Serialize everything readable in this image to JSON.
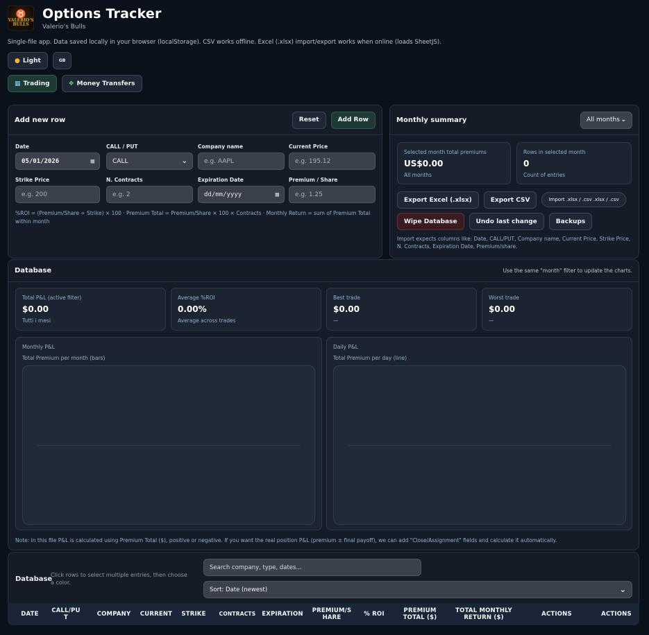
{
  "app": {
    "logo_text": "VALERIO'S BULLS",
    "title": "Options Tracker",
    "subtitle": "Valerio's Bulls",
    "note": "Single-file app. Data saved locally in your browser (localStorage). CSV works offline. Excel (.xlsx) import/export works when online (loads SheetJS)."
  },
  "toolbar": {
    "light_label": "Light",
    "gb_label": "GB"
  },
  "nav": {
    "trading_label": "Trading",
    "money_label": "Money Transfers"
  },
  "add_row": {
    "title": "Add new row",
    "reset_label": "Reset",
    "add_label": "Add Row",
    "fields": {
      "date_label": "Date",
      "date_value": "05/01/2026",
      "callput_label": "CALL / PUT",
      "callput_value": "CALL",
      "company_label": "Company name",
      "company_placeholder": "e.g. AAPL",
      "price_label": "Current Price",
      "price_placeholder": "e.g. 195.12",
      "strike_label": "Strike Price",
      "strike_placeholder": "e.g. 200",
      "contracts_label": "N. Contracts",
      "contracts_placeholder": "e.g. 2",
      "expiration_label": "Expiration Date",
      "expiration_placeholder": "dd/mm/yyyy",
      "premium_label": "Premium / Share",
      "premium_placeholder": "e.g. 1.25"
    },
    "formula_note": "%ROI = (Premium/Share ÷ Strike) × 100 · Premium Total = Premium/Share × 100 × Contracts · Monthly Return = sum of Premium Total within month"
  },
  "monthly": {
    "title": "Monthly summary",
    "filter_value": "All months",
    "total_label": "Selected month total premiums",
    "total_value": "US$0.00",
    "total_sub": "All months",
    "rows_label": "Rows in selected month",
    "rows_value": "0",
    "rows_sub": "Count of entries",
    "export_excel": "Export Excel (.xlsx)",
    "export_csv": "Export CSV",
    "import_label": "Import .xlsx / .csv  .xlsx / .csv",
    "wipe_label": "Wipe Database",
    "undo_label": "Undo last change",
    "backups_label": "Backups",
    "import_note": "Import expects columns like: Date, CALL/PUT, Company name, Current Price, Strike Price, N. Contracts, Expiration Date, Premium/share."
  },
  "database": {
    "title": "Database",
    "hint": "Use the same \"month\" filter to update the charts.",
    "stats": [
      {
        "label": "Total P&L (active filter)",
        "value": "$0.00",
        "sub": "Tutti i mesi"
      },
      {
        "label": "Average %ROI",
        "value": "0.00%",
        "sub": "Average across trades"
      },
      {
        "label": "Best trade",
        "value": "$0.00",
        "sub": "—"
      },
      {
        "label": "Worst trade",
        "value": "$0.00",
        "sub": "—"
      }
    ],
    "monthly_chart_title": "Monthly P&L",
    "monthly_chart_sub": "Total Premium per month (bars)",
    "daily_chart_title": "Daily P&L",
    "daily_chart_sub": "Total Premium per day (line)",
    "footnote": "Note: in this file P&L is calculated using Premium Total ($), positive or negative. If you want the real position P&L (premium ± final payoff), we can add \"Close/Assignment\" fields and calculate it automatically."
  },
  "table": {
    "title": "Database",
    "hint": "Click rows to select multiple entries, then choose a color.",
    "search_placeholder": "Search company, type, dates...",
    "sort_value": "Sort: Date (newest)",
    "columns": [
      "DATE",
      "CALL/PU T",
      "COMPANY",
      "CURRENT",
      "STRIKE",
      "CONTRACTS",
      "EXPIRATION",
      "PREMIUM/S HARE",
      "% ROI",
      "PREMIUM TOTAL ($)",
      "TOTAL MONTHLY RETURN ($)",
      "ACTIONS",
      "ACTIONS"
    ]
  },
  "colors": {
    "background": "#0b111b",
    "panel": "#151c27",
    "accent_green": "#1d3a34",
    "danger": "#3a1b22",
    "label_blue": "#8fb0cf"
  }
}
